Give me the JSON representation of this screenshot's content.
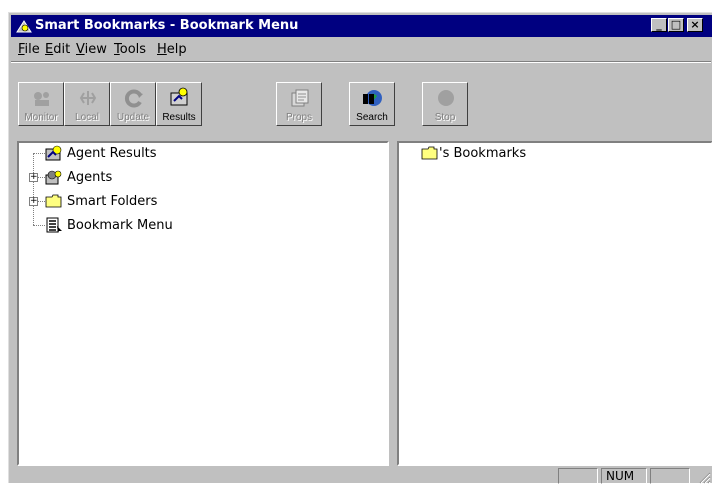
{
  "window": {
    "title": "Smart Bookmarks - Bookmark Menu"
  },
  "menu": [
    {
      "label": "File",
      "key": "F",
      "rest": "ile"
    },
    {
      "label": "Edit",
      "key": "E",
      "rest": "dit"
    },
    {
      "label": "View",
      "key": "V",
      "rest": "iew"
    },
    {
      "label": "Tools",
      "key": "T",
      "rest": "ools"
    },
    {
      "label": "Help",
      "key": "H",
      "rest": "elp"
    }
  ],
  "toolbar": {
    "monitor": "Monitor",
    "local": "Local",
    "update": "Update",
    "results": "Results",
    "props": "Props",
    "search": "Search",
    "stop": "Stop"
  },
  "tree": {
    "agent_results": "Agent Results",
    "agents": "Agents",
    "smart_folders": "Smart Folders",
    "bookmark_menu": "Bookmark Menu"
  },
  "right_pane": {
    "item": "'s Bookmarks"
  },
  "status": {
    "num": "NUM"
  }
}
